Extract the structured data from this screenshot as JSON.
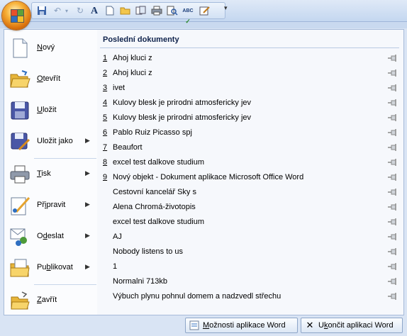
{
  "qat": {
    "icons": [
      "save-icon",
      "undo-icon",
      "redo-icon",
      "text-icon",
      "new-document-icon",
      "open-folder-icon",
      "copy-icon",
      "print-icon",
      "print-preview-icon",
      "spelling-icon",
      "edit-icon"
    ]
  },
  "menu_items": [
    {
      "label": "Nový",
      "accel": "N",
      "submenu": false
    },
    {
      "label": "Otevřít",
      "accel": "O",
      "submenu": false
    },
    {
      "label": "Uložit",
      "accel": "U",
      "submenu": false
    },
    {
      "label": "Uložit jako",
      "accel": "j",
      "submenu": true
    },
    {
      "label": "Tisk",
      "accel": "T",
      "submenu": true
    },
    {
      "label": "Připravit",
      "accel": "i",
      "submenu": true
    },
    {
      "label": "Odeslat",
      "accel": "d",
      "submenu": true
    },
    {
      "label": "Publikovat",
      "accel": "b",
      "submenu": true
    },
    {
      "label": "Zavřít",
      "accel": "Z",
      "submenu": false
    }
  ],
  "recent": {
    "title": "Poslední dokumenty",
    "documents": [
      {
        "num": "1",
        "name": "Ahoj  kluci  z"
      },
      {
        "num": "2",
        "name": "Ahoj  kluci  z"
      },
      {
        "num": "3",
        "name": "ivet"
      },
      {
        "num": "4",
        "name": "Kulovy blesk je prirodni atmosfericky jev"
      },
      {
        "num": "5",
        "name": "Kulovy blesk je prirodni atmosfericky jev"
      },
      {
        "num": "6",
        "name": "Pablo Ruiz Picasso spj"
      },
      {
        "num": "7",
        "name": "Beaufort"
      },
      {
        "num": "8",
        "name": "excel test dalkove studium"
      },
      {
        "num": "9",
        "name": "Nový objekt - Dokument aplikace Microsoft Office Word"
      },
      {
        "num": "",
        "name": "Cestovní kancelář  Sky s"
      },
      {
        "num": "",
        "name": "Alena Chromá-životopis"
      },
      {
        "num": "",
        "name": "excel test dalkove studium"
      },
      {
        "num": "",
        "name": "AJ"
      },
      {
        "num": "",
        "name": "Nobody listens to us"
      },
      {
        "num": "",
        "name": "1"
      },
      {
        "num": "",
        "name": "Normalni     713kb"
      },
      {
        "num": "",
        "name": "Výbuch plynu pohnul domem a nadzvedl střechu"
      }
    ]
  },
  "buttons": {
    "options": "Možnosti aplikace Word",
    "exit": "Ukončit aplikaci Word"
  }
}
